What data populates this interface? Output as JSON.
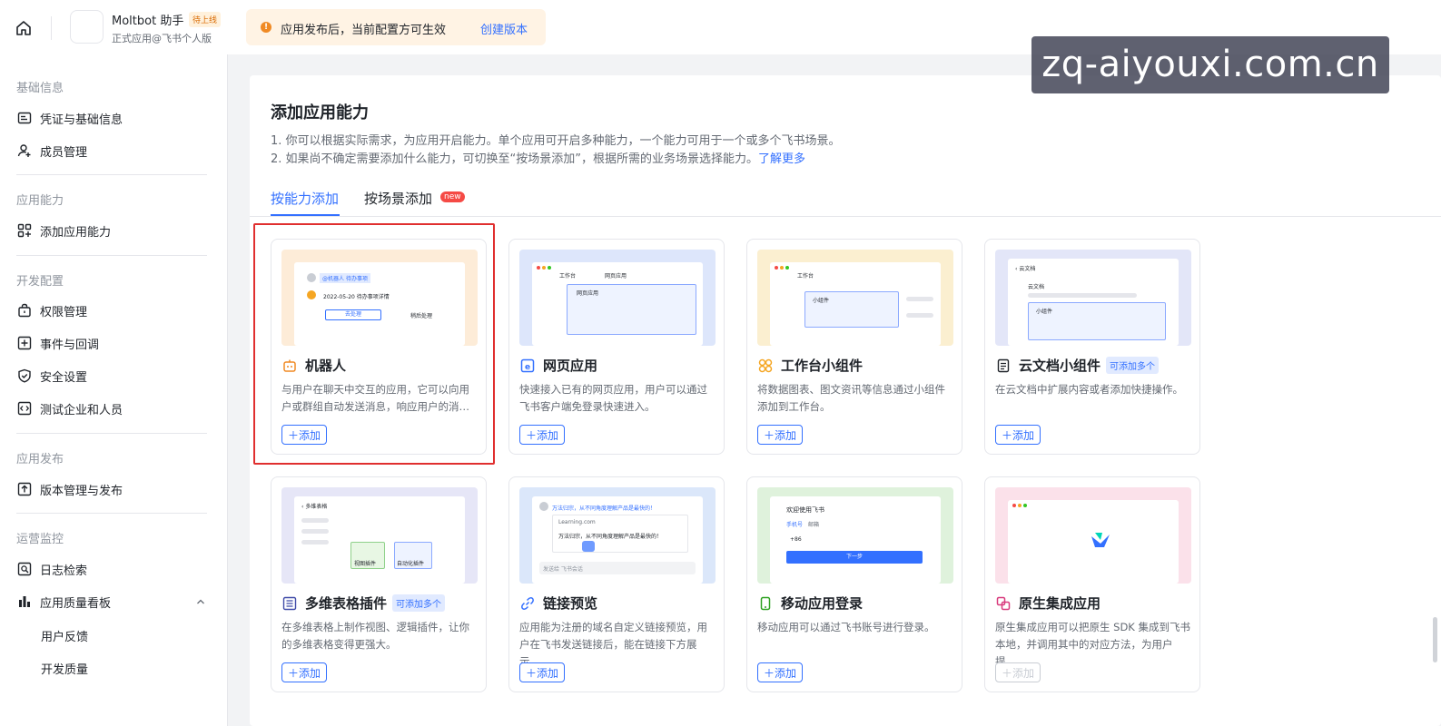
{
  "header": {
    "app_name": "Moltbot 助手",
    "app_badge": "待上线",
    "app_subtitle": "正式应用@飞书个人版",
    "notice_text": "应用发布后，当前配置方可生效",
    "notice_link": "创建版本",
    "watermark": "zq-aiyouxi.com.cn"
  },
  "sidebar": {
    "groups": [
      {
        "title": "基础信息",
        "items": [
          {
            "label": "凭证与基础信息",
            "icon": "id-card-icon"
          },
          {
            "label": "成员管理",
            "icon": "user-add-icon"
          }
        ]
      },
      {
        "title": "应用能力",
        "items": [
          {
            "label": "添加应用能力",
            "icon": "apps-add-icon"
          }
        ]
      },
      {
        "title": "开发配置",
        "items": [
          {
            "label": "权限管理",
            "icon": "lock-bag-icon"
          },
          {
            "label": "事件与回调",
            "icon": "event-icon"
          },
          {
            "label": "安全设置",
            "icon": "shield-icon"
          },
          {
            "label": "测试企业和人员",
            "icon": "code-icon"
          }
        ]
      },
      {
        "title": "应用发布",
        "items": [
          {
            "label": "版本管理与发布",
            "icon": "upload-icon"
          }
        ]
      },
      {
        "title": "运营监控",
        "items": [
          {
            "label": "日志检索",
            "icon": "log-search-icon"
          },
          {
            "label": "应用质量看板",
            "icon": "bar-chart-icon"
          }
        ],
        "subitems": [
          "用户反馈",
          "开发质量"
        ]
      }
    ]
  },
  "main": {
    "title": "添加应用能力",
    "desc1": "1. 你可以根据实际需求，为应用开启能力。单个应用可开启多种能力，一个能力可用于一个或多个飞书场景。",
    "desc2": "2. 如果尚不确定需要添加什么能力，可切换至“按场景添加”，根据所需的业务场景选择能力。",
    "desc2_link": "了解更多",
    "tabs": [
      {
        "label": "按能力添加"
      },
      {
        "label": "按场景添加"
      }
    ],
    "new_badge": "new",
    "add_label": "添加",
    "multi_badge": "可添加多个",
    "cards": [
      {
        "title": "机器人",
        "desc": "与用户在聊天中交互的应用，它可以向用户或群组自动发送消息，响应用户的消…",
        "icon": "robot-icon",
        "tint": "#fdecd8"
      },
      {
        "title": "网页应用",
        "desc": "快速接入已有的网页应用，用户可以通过飞书客户端免登录快速进入。",
        "icon": "web-app-icon",
        "tint": "#dde6fb"
      },
      {
        "title": "工作台小组件",
        "desc": "将数据图表、图文资讯等信息通过小组件添加到工作台。",
        "icon": "widget-icon",
        "tint": "#fbefd0"
      },
      {
        "title": "云文档小组件",
        "desc": "在云文档中扩展内容或者添加快捷操作。",
        "icon": "doc-icon",
        "tint": "#e3e6f8"
      },
      {
        "title": "多维表格插件",
        "desc": "在多维表格上制作视图、逻辑插件，让你的多维表格变得更强大。",
        "icon": "bitable-icon",
        "tint": "#e6e6f7"
      },
      {
        "title": "链接预览",
        "desc": "应用能为注册的域名自定义链接预览，用户在飞书发送链接后，能在链接下方展示…",
        "icon": "link-icon",
        "tint": "#dbe7fa"
      },
      {
        "title": "移动应用登录",
        "desc": "移动应用可以通过飞书账号进行登录。",
        "icon": "mobile-icon",
        "tint": "#dff2dc"
      },
      {
        "title": "原生集成应用",
        "desc": "原生集成应用可以把原生 SDK 集成到飞书本地，并调用其中的对应方法，为用户提…",
        "icon": "native-app-icon",
        "tint": "#fbe1ea"
      }
    ],
    "previews": {
      "bot_tag": "@机器人",
      "bot_msg_title": "待办事项",
      "bot_date": "2022-05-20 待办事项详情",
      "bot_btn1": "去处理",
      "bot_btn2": "稍后处理",
      "web_tab1": "工作台",
      "web_tab2": "网页应用",
      "web_box": "网页应用",
      "widget_tab": "工作台",
      "widget_box": "小组件",
      "doc_title": "云文档",
      "doc_sub": "云文档",
      "doc_box": "小组件",
      "bitable_title": "多维表格",
      "bitable_a": "视图插件",
      "bitable_b": "自动化插件",
      "link_msg": "万法归宗，从不同角度理解产品是最快的！",
      "link_url": "Learning.com",
      "link_body": "万法归宗，从不同角度理解产品是最快的！",
      "link_input": "发送给 飞书会话",
      "login_title": "欢迎使用飞书",
      "login_tab1": "手机号",
      "login_tab2": "邮箱",
      "login_code": "+86",
      "login_btn": "下一步"
    }
  }
}
